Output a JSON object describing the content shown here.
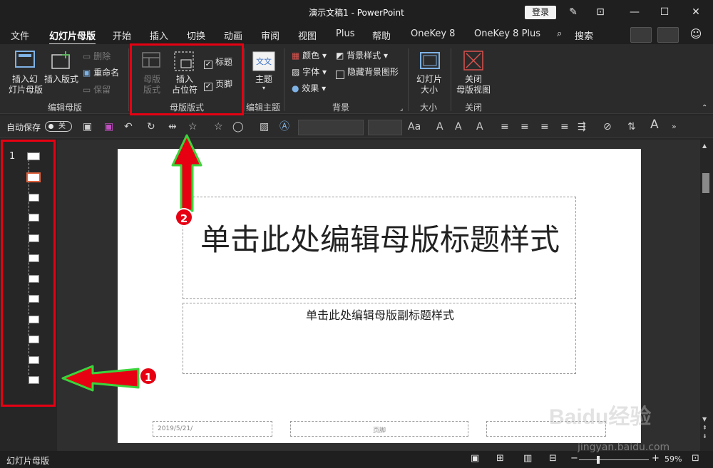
{
  "window": {
    "title": "演示文稿1  -  PowerPoint",
    "login_label": "登录",
    "controls": [
      "pen-icon",
      "ribbon-display-icon",
      "minimize-icon",
      "maximize-icon",
      "close-icon"
    ]
  },
  "menu": {
    "items": [
      "文件",
      "幻灯片母版",
      "开始",
      "插入",
      "切换",
      "动画",
      "审阅",
      "视图",
      "Plus",
      "帮助",
      "OneKey 8",
      "OneKey 8 Plus"
    ],
    "active": "幻灯片母版",
    "search_label": "搜索"
  },
  "ribbon": {
    "edit_master": {
      "label": "编辑母版",
      "insert_slide_master": "插入幻\n灯片母版",
      "insert_layout": "插入版式",
      "delete": "删除",
      "rename": "重命名",
      "preserve": "保留"
    },
    "master_layout": {
      "label": "母版版式",
      "master_layout_btn": "母版\n版式",
      "insert_placeholder": "插入\n占位符",
      "title_check": "标题",
      "footer_check": "页脚"
    },
    "edit_theme": {
      "label": "编辑主题",
      "themes": "主题"
    },
    "background": {
      "label": "背景",
      "colors": "颜色",
      "fonts": "字体",
      "effects": "效果",
      "background_styles": "背景样式",
      "hide_background_graphics": "隐藏背景图形"
    },
    "size": {
      "label": "大小",
      "slide_size": "幻灯片\n大小"
    },
    "close": {
      "label": "关闭",
      "close_master_view": "关闭\n母版视图"
    }
  },
  "qat": {
    "autosave_label": "自动保存",
    "autosave_state": "关"
  },
  "thumbnails": {
    "number": "1",
    "count": 12,
    "selected_index": 1
  },
  "slide": {
    "title_placeholder": "单击此处编辑母版标题样式",
    "subtitle_placeholder": "单击此处编辑母版副标题样式",
    "date": "2019/5/21/",
    "footer": "页脚"
  },
  "status": {
    "view_label": "幻灯片母版",
    "zoom": "59%"
  },
  "annotations": {
    "badge_1": "1",
    "badge_2": "2",
    "highlight_color": "#e60012",
    "arrow_color": "#e60012",
    "arrow_outline": "#3cd43c"
  },
  "watermark": {
    "brand": "Baidu经验",
    "url": "jingyan.baidu.com"
  }
}
